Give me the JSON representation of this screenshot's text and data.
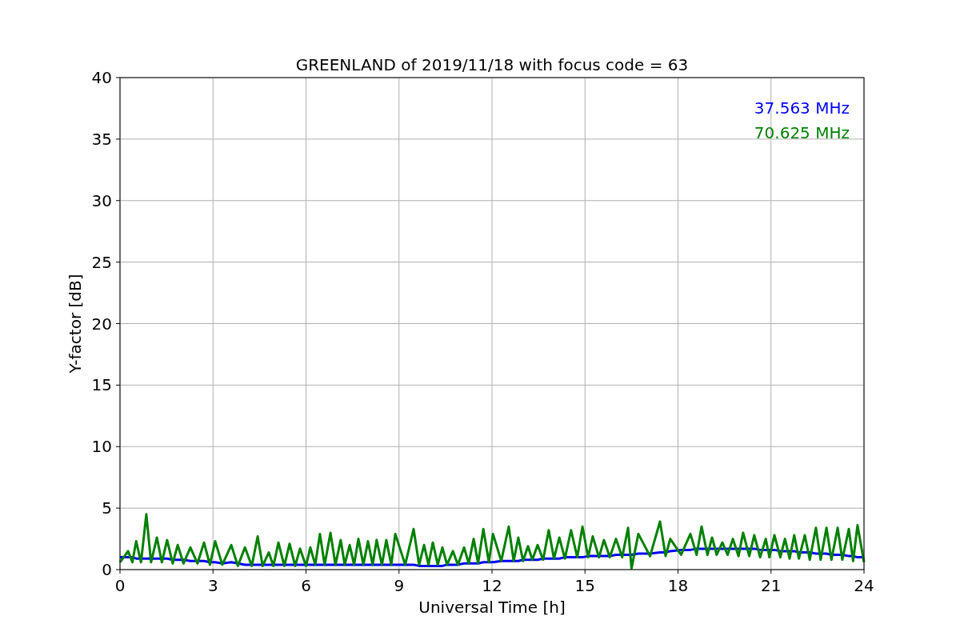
{
  "chart_data": {
    "type": "line",
    "title": "GREENLAND of 2019/11/18 with focus code = 63",
    "xlabel": "Universal Time [h]",
    "ylabel": "Y-factor [dB]",
    "grid": true,
    "xlim": [
      0,
      24
    ],
    "ylim": [
      0,
      40
    ],
    "xticks": [
      0,
      3,
      6,
      9,
      12,
      15,
      18,
      21,
      24
    ],
    "yticks": [
      0,
      5,
      10,
      15,
      20,
      25,
      30,
      35,
      40
    ],
    "x": [
      0,
      0.26,
      0.4,
      0.52,
      0.68,
      0.85,
      1.0,
      1.19,
      1.35,
      1.52,
      1.7,
      1.86,
      2.05,
      2.27,
      2.5,
      2.71,
      2.9,
      3.07,
      3.3,
      3.59,
      3.8,
      4.03,
      4.25,
      4.44,
      4.6,
      4.8,
      4.95,
      5.11,
      5.3,
      5.47,
      5.65,
      5.81,
      6.0,
      6.14,
      6.3,
      6.45,
      6.6,
      6.79,
      6.95,
      7.12,
      7.25,
      7.41,
      7.55,
      7.69,
      7.85,
      8.0,
      8.15,
      8.28,
      8.45,
      8.59,
      8.75,
      8.88,
      9.2,
      9.47,
      9.65,
      9.81,
      9.95,
      10.09,
      10.25,
      10.4,
      10.55,
      10.74,
      10.9,
      11.1,
      11.25,
      11.41,
      11.55,
      11.72,
      11.9,
      12.03,
      12.3,
      12.54,
      12.7,
      12.85,
      13.0,
      13.16,
      13.3,
      13.47,
      13.65,
      13.83,
      14.0,
      14.17,
      14.35,
      14.55,
      14.75,
      14.92,
      15.1,
      15.25,
      15.45,
      15.61,
      15.8,
      16.0,
      16.2,
      16.39,
      16.5,
      16.72,
      17.1,
      17.42,
      17.6,
      17.75,
      18.1,
      18.4,
      18.6,
      18.76,
      18.95,
      19.1,
      19.25,
      19.43,
      19.6,
      19.77,
      19.95,
      20.1,
      20.3,
      20.46,
      20.65,
      20.83,
      20.95,
      21.11,
      21.3,
      21.45,
      21.6,
      21.75,
      21.9,
      22.09,
      22.25,
      22.45,
      22.6,
      22.79,
      22.95,
      23.15,
      23.3,
      23.51,
      23.65,
      23.79,
      24
    ],
    "series": [
      {
        "name": "37.563 MHz",
        "color": "#0000ff",
        "values": [
          1.0,
          1.0,
          1.0,
          0.9,
          0.9,
          0.9,
          0.9,
          0.9,
          0.9,
          0.9,
          0.8,
          0.8,
          0.8,
          0.7,
          0.7,
          0.7,
          0.6,
          0.6,
          0.5,
          0.6,
          0.5,
          0.4,
          0.4,
          0.4,
          0.4,
          0.4,
          0.4,
          0.4,
          0.4,
          0.4,
          0.4,
          0.4,
          0.4,
          0.4,
          0.4,
          0.4,
          0.4,
          0.4,
          0.4,
          0.4,
          0.4,
          0.4,
          0.4,
          0.4,
          0.4,
          0.4,
          0.4,
          0.4,
          0.4,
          0.4,
          0.4,
          0.4,
          0.4,
          0.4,
          0.3,
          0.3,
          0.3,
          0.3,
          0.3,
          0.3,
          0.4,
          0.4,
          0.4,
          0.5,
          0.5,
          0.5,
          0.5,
          0.6,
          0.6,
          0.6,
          0.7,
          0.7,
          0.7,
          0.7,
          0.8,
          0.8,
          0.8,
          0.8,
          0.9,
          0.9,
          0.9,
          0.9,
          1.0,
          1.0,
          1.0,
          1.0,
          1.1,
          1.1,
          1.1,
          1.1,
          1.1,
          1.2,
          1.2,
          1.2,
          1.2,
          1.3,
          1.3,
          1.4,
          1.4,
          1.5,
          1.6,
          1.6,
          1.7,
          1.7,
          1.7,
          1.7,
          1.7,
          1.7,
          1.7,
          1.7,
          1.7,
          1.7,
          1.7,
          1.7,
          1.6,
          1.6,
          1.6,
          1.6,
          1.5,
          1.5,
          1.5,
          1.5,
          1.4,
          1.4,
          1.4,
          1.3,
          1.3,
          1.3,
          1.2,
          1.2,
          1.2,
          1.1,
          1.1,
          1.0,
          1.0
        ]
      },
      {
        "name": "70.625 MHz",
        "color": "#008000",
        "values": [
          0.6,
          1.5,
          0.6,
          2.3,
          0.6,
          4.5,
          0.6,
          2.6,
          0.6,
          2.4,
          0.5,
          2.0,
          0.5,
          1.8,
          0.5,
          2.2,
          0.4,
          2.3,
          0.4,
          2.0,
          0.3,
          1.8,
          0.3,
          2.7,
          0.3,
          1.4,
          0.3,
          2.2,
          0.3,
          2.1,
          0.3,
          1.7,
          0.3,
          1.8,
          0.4,
          2.9,
          0.4,
          3.0,
          0.4,
          2.4,
          0.4,
          2.0,
          0.4,
          2.5,
          0.4,
          2.3,
          0.4,
          2.4,
          0.4,
          2.4,
          0.4,
          2.9,
          0.4,
          3.3,
          0.4,
          2.0,
          0.4,
          2.2,
          0.4,
          1.8,
          0.4,
          1.5,
          0.4,
          1.8,
          0.5,
          2.5,
          0.5,
          3.3,
          0.6,
          2.9,
          0.7,
          3.5,
          0.7,
          2.6,
          0.7,
          1.9,
          0.8,
          2.0,
          0.8,
          3.2,
          0.9,
          2.6,
          0.9,
          3.2,
          1.0,
          3.5,
          1.0,
          2.7,
          1.0,
          2.4,
          1.0,
          2.5,
          1.0,
          3.4,
          0.1,
          2.9,
          1.1,
          3.9,
          1.1,
          2.5,
          1.2,
          2.9,
          1.2,
          3.5,
          1.2,
          2.6,
          1.2,
          2.2,
          1.2,
          2.5,
          1.1,
          3.0,
          1.1,
          2.8,
          1.0,
          2.5,
          1.0,
          2.8,
          1.0,
          2.5,
          0.9,
          2.8,
          0.9,
          2.8,
          0.8,
          3.4,
          0.8,
          3.4,
          0.8,
          3.4,
          0.8,
          3.3,
          0.7,
          3.6,
          0.6
        ]
      }
    ]
  }
}
